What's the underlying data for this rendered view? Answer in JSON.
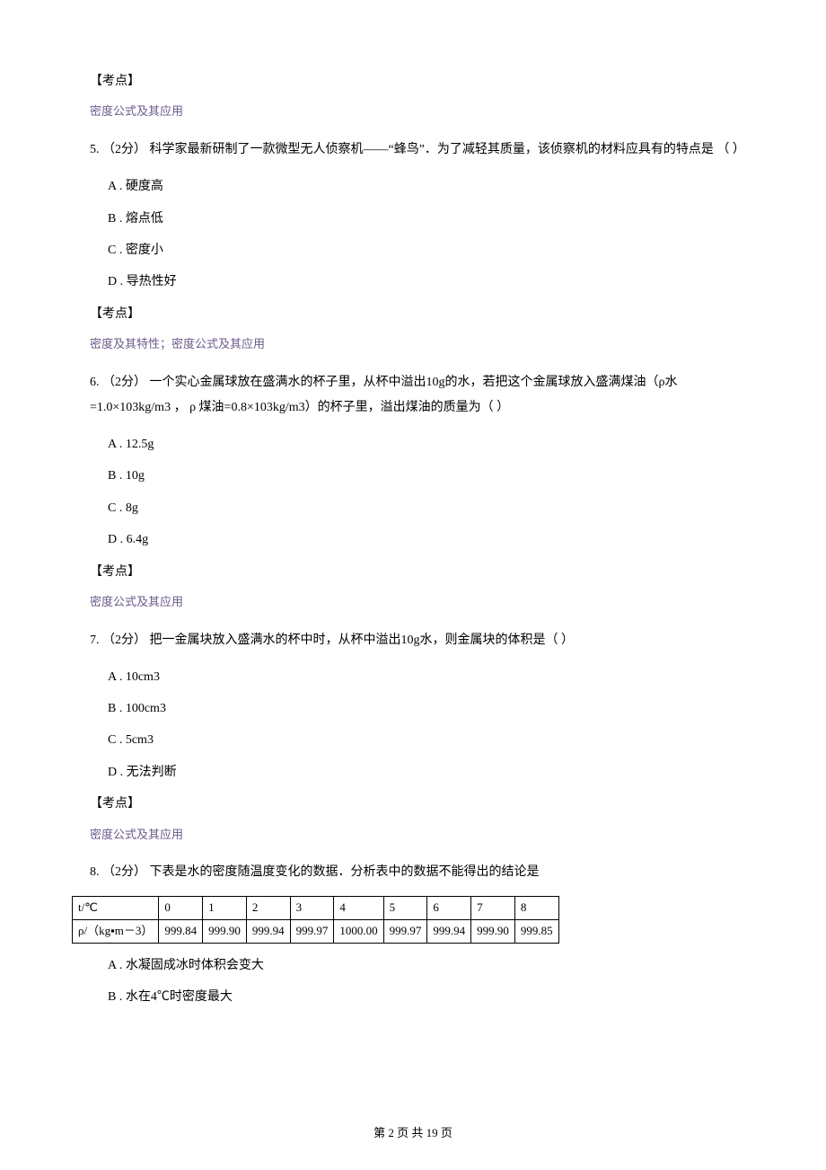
{
  "kaodian_label": "【考点】",
  "tags": {
    "density_formula": "密度公式及其应用",
    "density_props_and_formula": "密度及其特性；密度公式及其应用"
  },
  "q5": {
    "stem": "5. （2分） 科学家最新研制了一款微型无人侦察机——“蜂鸟”．为了减轻其质量，该侦察机的材料应具有的特点是        （     ）",
    "A": "A . 硬度高",
    "B": "B . 熔点低",
    "C": "C . 密度小",
    "D": "D . 导热性好"
  },
  "q6": {
    "stem": "6. （2分） 一个实心金属球放在盛满水的杯子里，从杯中溢出10g的水，若把这个金属球放入盛满煤油（ρ水=1.0×103kg/m3 ，  ρ 煤油=0.8×103kg/m3）的杯子里，溢出煤油的质量为（    ）",
    "A": "A . 12.5g",
    "B": "B . 10g",
    "C": "C . 8g",
    "D": "D . 6.4g"
  },
  "q7": {
    "stem": "7. （2分） 把一金属块放入盛满水的杯中时，从杯中溢出10g水，则金属块的体积是（    ）",
    "A": "A . 10cm3",
    "B": "B . 100cm3",
    "C": "C . 5cm3",
    "D": "D . 无法判断"
  },
  "q8": {
    "stem": "8. （2分） 下表是水的密度随温度变化的数据．分析表中的数据不能得出的结论是",
    "A": "A . 水凝固成冰时体积会变大",
    "B": "B . 水在4℃时密度最大"
  },
  "chart_data": {
    "type": "table",
    "columns": [
      "t/℃",
      "0",
      "1",
      "2",
      "3",
      "4",
      "5",
      "6",
      "7",
      "8"
    ],
    "rows": [
      {
        "label": "ρ/（kg▪m－3）",
        "values": [
          "999.84",
          "999.90",
          "999.94",
          "999.97",
          "1000.00",
          "999.97",
          "999.94",
          "999.90",
          "999.85"
        ]
      }
    ]
  },
  "footer": "第 2 页 共 19 页"
}
